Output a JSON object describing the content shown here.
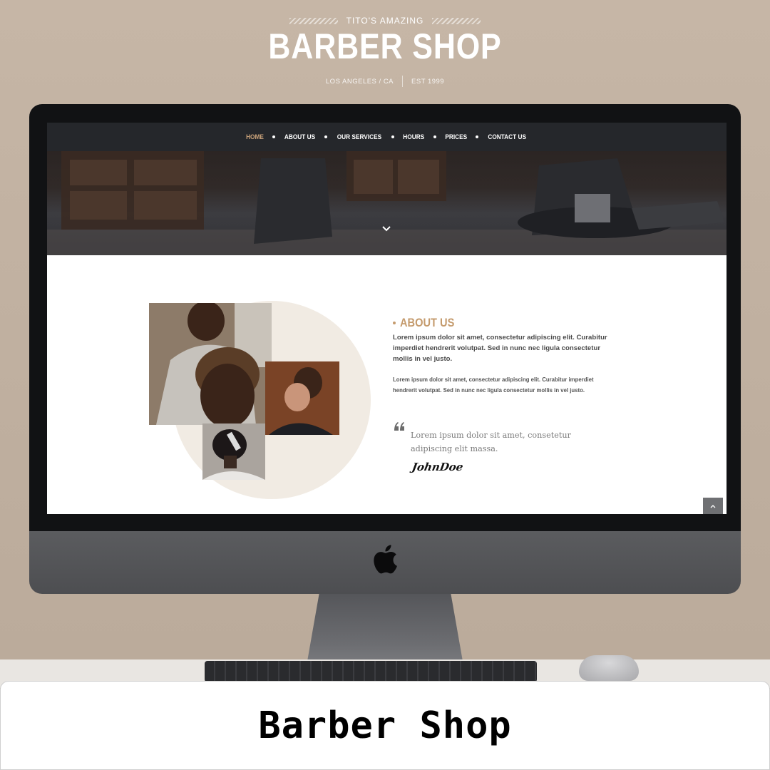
{
  "brand": {
    "eyebrow": "TITO'S AMAZING",
    "title": "BARBER SHOP",
    "location": "LOS ANGELES / CA",
    "established": "EST 1999"
  },
  "nav": {
    "items": [
      {
        "label": "HOME",
        "active": true
      },
      {
        "label": "ABOUT US"
      },
      {
        "label": "OUR SERVICES"
      },
      {
        "label": "HOURS"
      },
      {
        "label": "PRICES"
      },
      {
        "label": "CONTACT US"
      }
    ]
  },
  "about": {
    "title": "ABOUT US",
    "paragraph_1": "Lorem ipsum dolor sit amet, consectetur adipiscing elit. Curabitur imperdiet hendrerit volutpat. Sed in nunc nec ligula consectetur mollis in vel justo.",
    "paragraph_2": "Lorem ipsum dolor sit amet, consectetur adipiscing elit. Curabitur imperdiet hendrerit volutpat. Sed in nunc nec ligula consectetur mollis in vel justo.",
    "quote": "Lorem ipsum dolor sit amet, consetetur adipiscing elit massa.",
    "signature": "JohnDoe"
  },
  "back_to_top_icon": "chevron-up-icon",
  "caption": "Barber Shop",
  "colors": {
    "accent": "#c49a6c",
    "nav_background": "#25272b",
    "page_background": "#c6b6a6"
  }
}
